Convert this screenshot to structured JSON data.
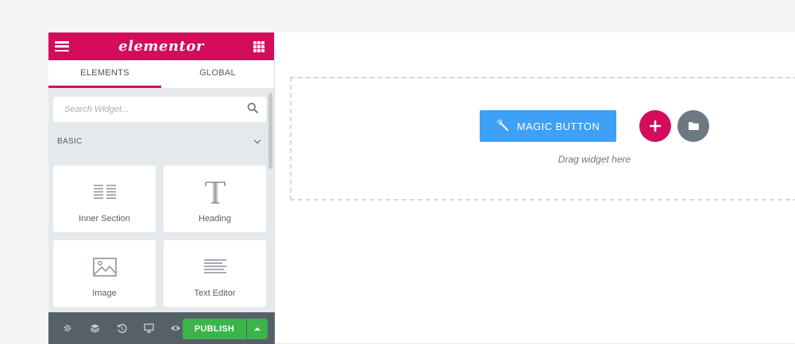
{
  "header": {
    "logo": "elementor"
  },
  "tabs": [
    {
      "label": "ELEMENTS",
      "active": true
    },
    {
      "label": "GLOBAL",
      "active": false
    }
  ],
  "search": {
    "placeholder": "Search Widget..."
  },
  "category": {
    "label": "BASIC"
  },
  "widgets": [
    {
      "label": "Inner Section",
      "icon": "inner-section-icon"
    },
    {
      "label": "Heading",
      "icon": "heading-icon"
    },
    {
      "label": "Image",
      "icon": "image-icon"
    },
    {
      "label": "Text Editor",
      "icon": "text-editor-icon"
    }
  ],
  "footer": {
    "publish_label": "PUBLISH"
  },
  "canvas": {
    "magic_button_label": "MAGIC BUTTON",
    "drag_text": "Drag widget here"
  },
  "colors": {
    "brand": "#d30c5c",
    "publish": "#39b54a",
    "magic": "#3ea0f6",
    "panel_bottom": "#556068"
  }
}
